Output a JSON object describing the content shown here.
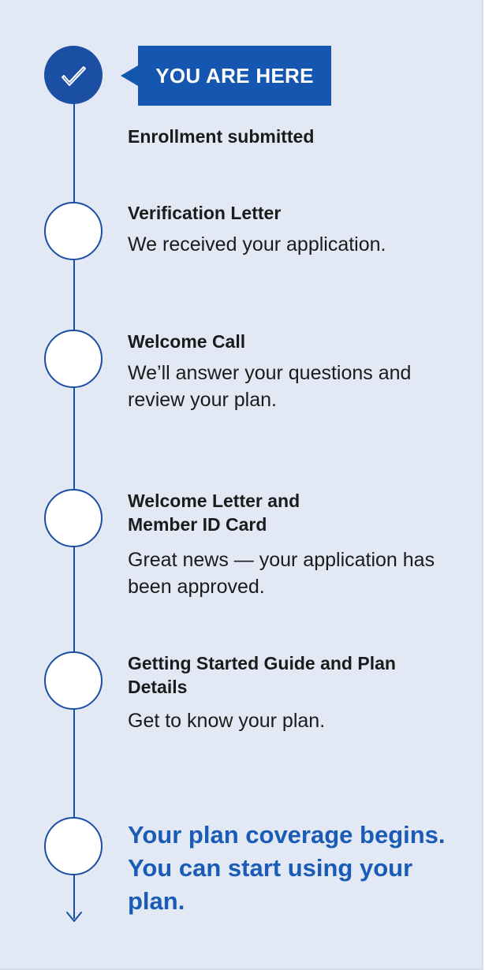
{
  "colors": {
    "background": "#e3e8f5",
    "accent": "#1a4fa3",
    "badge": "#1557b0",
    "final_text": "#1a5cb5"
  },
  "current_marker": {
    "icon": "checkmark-icon",
    "badge_label": "YOU ARE HERE"
  },
  "steps": [
    {
      "title": "Enrollment submitted",
      "status": "current"
    },
    {
      "title": "Verification Letter",
      "description": "We received your application.",
      "status": "upcoming"
    },
    {
      "title": "Welcome Call",
      "description": "We’ll answer your questions and review your plan.",
      "status": "upcoming"
    },
    {
      "title": "Welcome Letter and Member ID Card",
      "description": "Great news — your application has been approved.",
      "status": "upcoming"
    },
    {
      "title": "Getting Started Guide and Plan Details",
      "description": "Get to know your plan.",
      "status": "upcoming"
    },
    {
      "title": "Your plan coverage begins. You can start using your plan.",
      "status": "upcoming"
    }
  ]
}
